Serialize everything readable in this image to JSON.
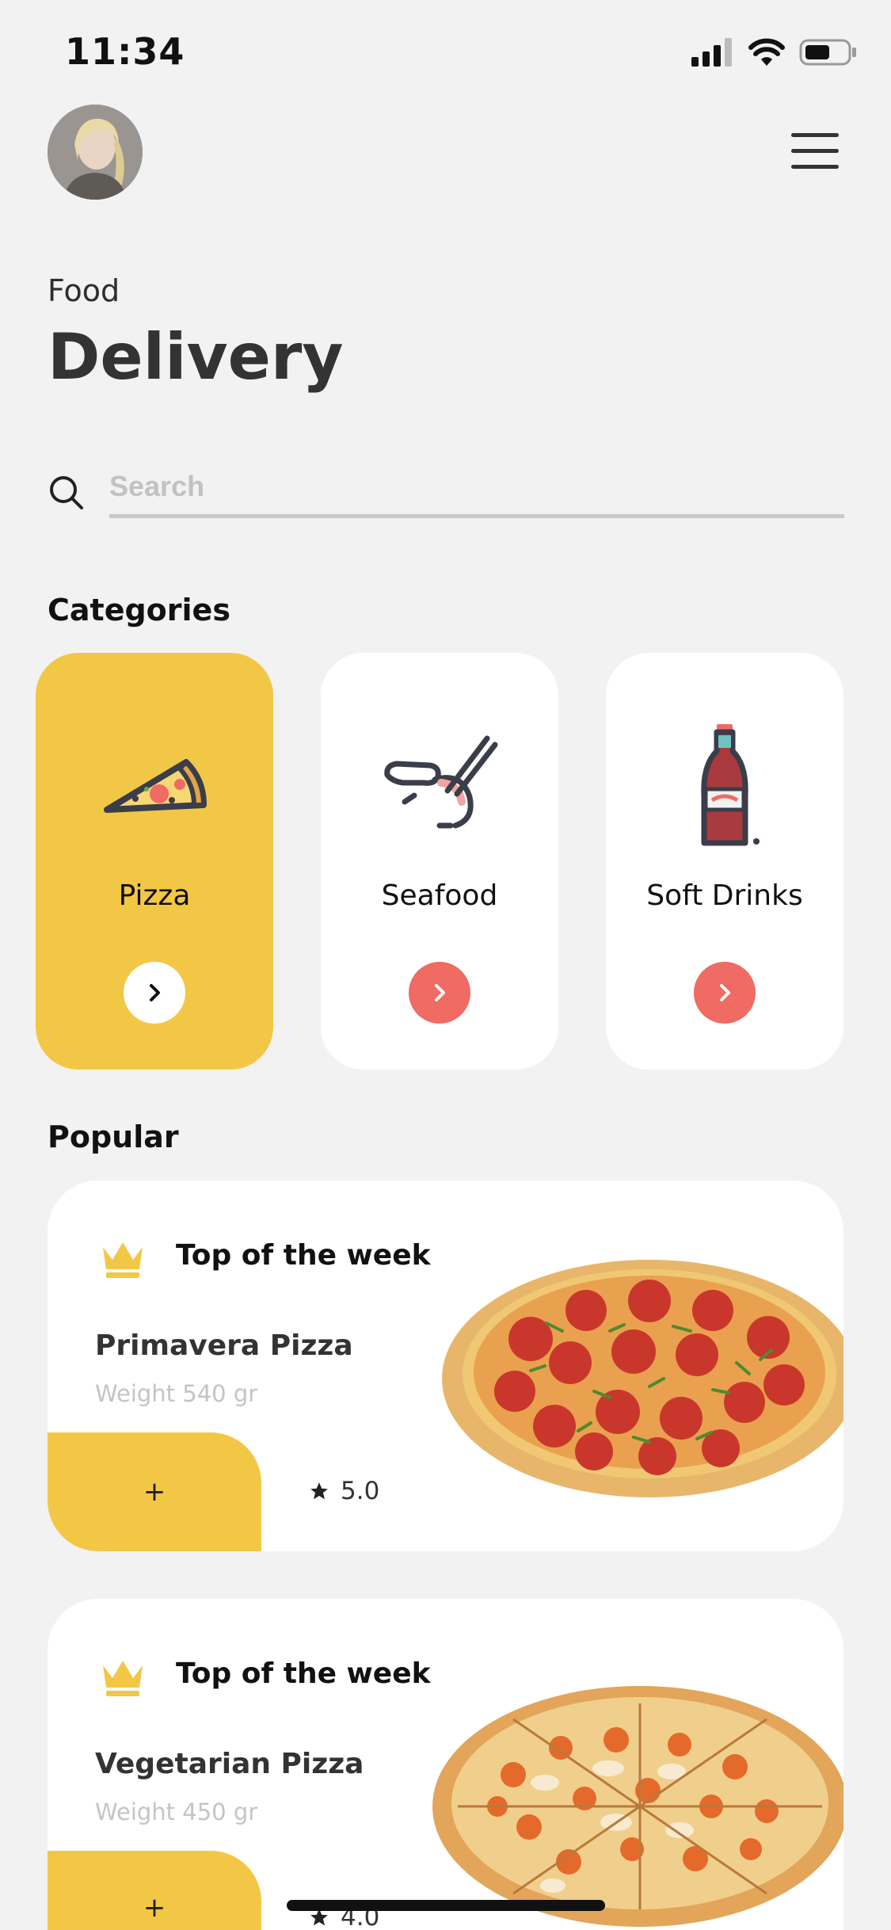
{
  "status": {
    "time": "11:34"
  },
  "header": {
    "subtitle": "Food",
    "title": "Delivery"
  },
  "search": {
    "placeholder": "Search"
  },
  "categories": {
    "title": "Categories",
    "items": [
      {
        "label": "Pizza",
        "icon": "pizza-slice-icon",
        "active": true
      },
      {
        "label": "Seafood",
        "icon": "shrimp-icon",
        "active": false
      },
      {
        "label": "Soft Drinks",
        "icon": "soda-bottle-icon",
        "active": false
      }
    ]
  },
  "popular": {
    "title": "Popular",
    "items": [
      {
        "badge": "Top of the week",
        "name": "Primavera Pizza",
        "weight": "Weight 540 gr",
        "add_label": "+",
        "rating": "5.0"
      },
      {
        "badge": "Top of the week",
        "name": "Vegetarian Pizza",
        "weight": "Weight 450 gr",
        "add_label": "+",
        "rating": "4.0"
      }
    ]
  },
  "colors": {
    "accent": "#f3c746",
    "action": "#ef6b63",
    "background": "#f2f2f2",
    "card": "#ffffff"
  }
}
